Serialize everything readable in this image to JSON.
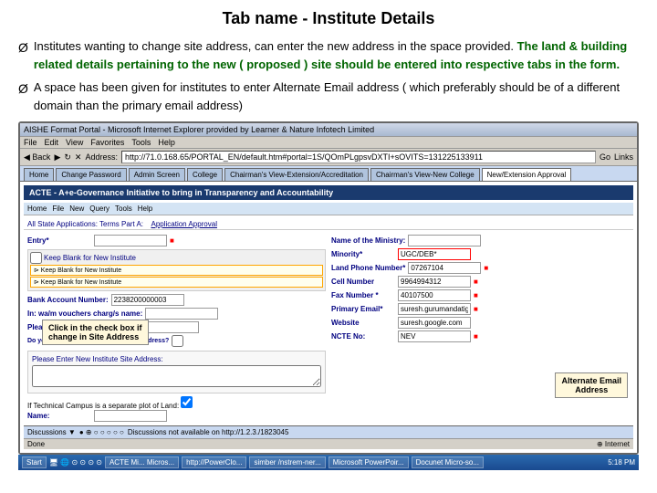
{
  "page": {
    "title": "Tab name - Institute Details"
  },
  "bullets": [
    {
      "id": "bullet1",
      "arrow": "Ø",
      "text_parts": [
        {
          "text": "Institutes wanting to change site address, can enter the new address in the space provided. ",
          "style": "normal"
        },
        {
          "text": "The land & building related details pertaining to  the new ( proposed ) site should be entered into respective tabs in the form.",
          "style": "bold-green"
        }
      ]
    },
    {
      "id": "bullet2",
      "arrow": "Ø",
      "text_parts": [
        {
          "text": "A space has been given for institutes to enter Alternate Email address ( which preferably should be of a different domain than the primary email address)",
          "style": "normal"
        }
      ]
    }
  ],
  "browser": {
    "titlebar": "AISHE Format Portal - Microsoft Internet Explorer provided by Learner & Nature Infotech Limited",
    "menu_items": [
      "File",
      "Edit",
      "View",
      "Favorites",
      "Tools",
      "Help"
    ],
    "address": "http://71.0.168.65/PORTAL_EN/default.htm#portal=1S/QOmPLgpsvDXTI+sOVITS=131225133911",
    "nav_tabs": [
      {
        "label": "Home",
        "active": false
      },
      {
        "label": "Change Password",
        "active": false
      },
      {
        "label": "Admin Screen",
        "active": false
      },
      {
        "label": "College",
        "active": false
      },
      {
        "label": "Chairman's View-Extension/Accreditation",
        "active": false
      },
      {
        "label": "Chairman's View-New College",
        "active": false
      },
      {
        "label": "New/Extension Approval",
        "active": true
      }
    ],
    "app_header": "ACTE - A+e-Governance Initiative to bring in Transparency and Accountability",
    "sub_nav_items": [
      "Home",
      "File",
      "New",
      "Query",
      "Tools",
      "Help"
    ]
  },
  "second_nav": [
    {
      "label": "All State Applications: Terms Part A:"
    }
  ],
  "form": {
    "left_fields": [
      {
        "label": "Entry*",
        "value": ""
      },
      {
        "label": "Bank Account Number:",
        "value": "2238200000003"
      },
      {
        "label": "In: wa/m vouchers charge/s name:",
        "value": ""
      },
      {
        "label": "Please Enter Institute Name",
        "value": ""
      },
      {
        "label": "Do you Wish to change Institute Site Address?",
        "value": ""
      }
    ],
    "right_fields": [
      {
        "label": "Name of the Ministry:",
        "value": ""
      },
      {
        "label": "Minority*",
        "value": "UGC/DEB*"
      },
      {
        "label": "Land Phone Number*",
        "value": "07267104"
      },
      {
        "label": "Cell Number",
        "value": "9964994312"
      },
      {
        "label": "Fax Number *",
        "value": "40107500"
      },
      {
        "label": "Primary Email*",
        "value": "suresh.gurumandatigg"
      },
      {
        "label": "Website",
        "value": "suresh.google.com"
      },
      {
        "label": "NCTE No:",
        "value": "NEV"
      }
    ],
    "checkbox_keep_blank": [
      {
        "text": "Keep Blank for New Institute"
      },
      {
        "text": "Keep Blank for New Institute"
      }
    ],
    "site_address_label": "Please Enter New Institute Site Address:",
    "technical_campus": "If Technical Campus is a separate plot of Land: ☑",
    "name_label": "Name:"
  },
  "callouts": {
    "check_site": "Click in the check  box if\nchange in Site Address",
    "alternate_email": "Alternate Email\nAddress"
  },
  "bottom_bar": {
    "discussions": "Discussions ▼",
    "icon_row": "● ⊕ ○ ○ ○ ○ ○",
    "text": "Discussions not available on http://1.2.3./1823045"
  },
  "status_bar": {
    "items": [
      "Done",
      ""
    ]
  },
  "taskbar": {
    "start": "Start",
    "items": [
      "ACTE Mi... Micros...",
      "http://PowerClo...",
      "simber /nstrem-ner...",
      "Microsoft PowerPoir...",
      "Docunet  Micro-so...",
      "time: 5:18 PM"
    ]
  }
}
